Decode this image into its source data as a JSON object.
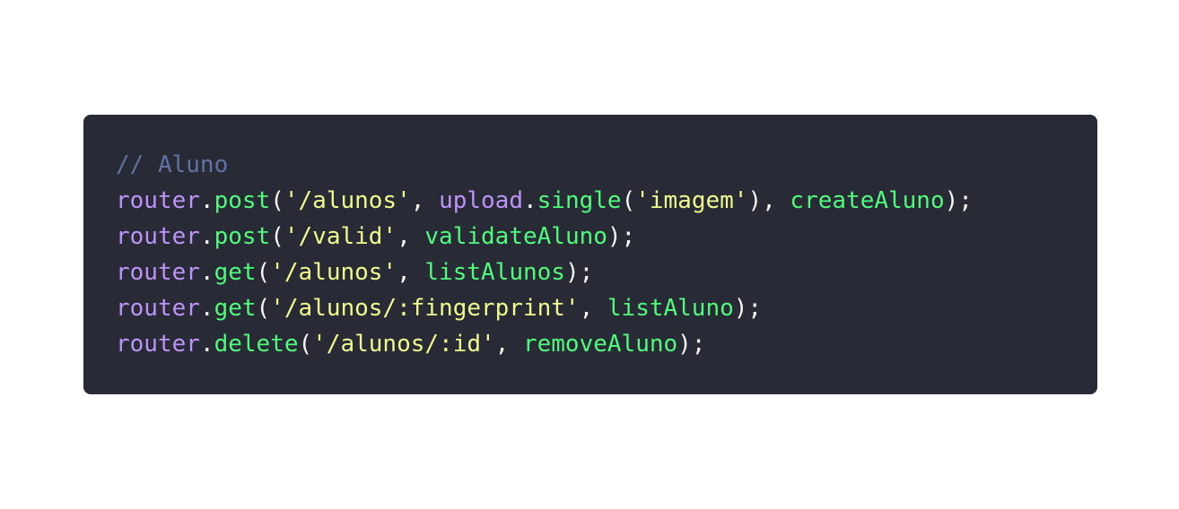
{
  "colors": {
    "background": "#ffffff",
    "panel": "#282a36",
    "comment": "#6272a4",
    "object": "#bd93f9",
    "method": "#50fa7b",
    "string": "#f1fa8c",
    "punct": "#f8f8f2"
  },
  "code_lines": [
    [
      {
        "t": "// Aluno",
        "k": "comment"
      }
    ],
    [
      {
        "t": "router",
        "k": "object"
      },
      {
        "t": ".",
        "k": "punct"
      },
      {
        "t": "post",
        "k": "method"
      },
      {
        "t": "(",
        "k": "punct"
      },
      {
        "t": "'/alunos'",
        "k": "string"
      },
      {
        "t": ", ",
        "k": "punct"
      },
      {
        "t": "upload",
        "k": "object"
      },
      {
        "t": ".",
        "k": "punct"
      },
      {
        "t": "single",
        "k": "method"
      },
      {
        "t": "(",
        "k": "punct"
      },
      {
        "t": "'imagem'",
        "k": "string"
      },
      {
        "t": "), ",
        "k": "punct"
      },
      {
        "t": "createAluno",
        "k": "method"
      },
      {
        "t": ");",
        "k": "punct"
      }
    ],
    [
      {
        "t": "router",
        "k": "object"
      },
      {
        "t": ".",
        "k": "punct"
      },
      {
        "t": "post",
        "k": "method"
      },
      {
        "t": "(",
        "k": "punct"
      },
      {
        "t": "'/valid'",
        "k": "string"
      },
      {
        "t": ", ",
        "k": "punct"
      },
      {
        "t": "validateAluno",
        "k": "method"
      },
      {
        "t": ");",
        "k": "punct"
      }
    ],
    [
      {
        "t": "router",
        "k": "object"
      },
      {
        "t": ".",
        "k": "punct"
      },
      {
        "t": "get",
        "k": "method"
      },
      {
        "t": "(",
        "k": "punct"
      },
      {
        "t": "'/alunos'",
        "k": "string"
      },
      {
        "t": ", ",
        "k": "punct"
      },
      {
        "t": "listAlunos",
        "k": "method"
      },
      {
        "t": ");",
        "k": "punct"
      }
    ],
    [
      {
        "t": "router",
        "k": "object"
      },
      {
        "t": ".",
        "k": "punct"
      },
      {
        "t": "get",
        "k": "method"
      },
      {
        "t": "(",
        "k": "punct"
      },
      {
        "t": "'/alunos/:fingerprint'",
        "k": "string"
      },
      {
        "t": ", ",
        "k": "punct"
      },
      {
        "t": "listAluno",
        "k": "method"
      },
      {
        "t": ");",
        "k": "punct"
      }
    ],
    [
      {
        "t": "router",
        "k": "object"
      },
      {
        "t": ".",
        "k": "punct"
      },
      {
        "t": "delete",
        "k": "method"
      },
      {
        "t": "(",
        "k": "punct"
      },
      {
        "t": "'/alunos/:id'",
        "k": "string"
      },
      {
        "t": ", ",
        "k": "punct"
      },
      {
        "t": "removeAluno",
        "k": "method"
      },
      {
        "t": ");",
        "k": "punct"
      }
    ]
  ]
}
